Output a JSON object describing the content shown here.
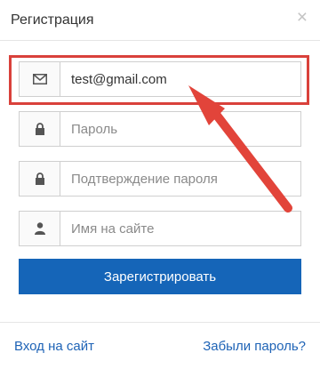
{
  "dialog": {
    "title": "Регистрация",
    "close_glyph": "×"
  },
  "form": {
    "email": {
      "value": "test@gmail.com",
      "icon": "envelope-icon"
    },
    "password": {
      "placeholder": "Пароль",
      "icon": "lock-icon"
    },
    "confirm_password": {
      "placeholder": "Подтверждение пароля",
      "icon": "lock-icon"
    },
    "username": {
      "placeholder": "Имя на сайте",
      "icon": "user-icon"
    },
    "submit_label": "Зарегистрировать"
  },
  "footer": {
    "login_link": "Вход на сайт",
    "forgot_link": "Забыли пароль?"
  },
  "colors": {
    "accent": "#1565b8",
    "highlight": "#d9413b",
    "link": "#1e63b6"
  }
}
